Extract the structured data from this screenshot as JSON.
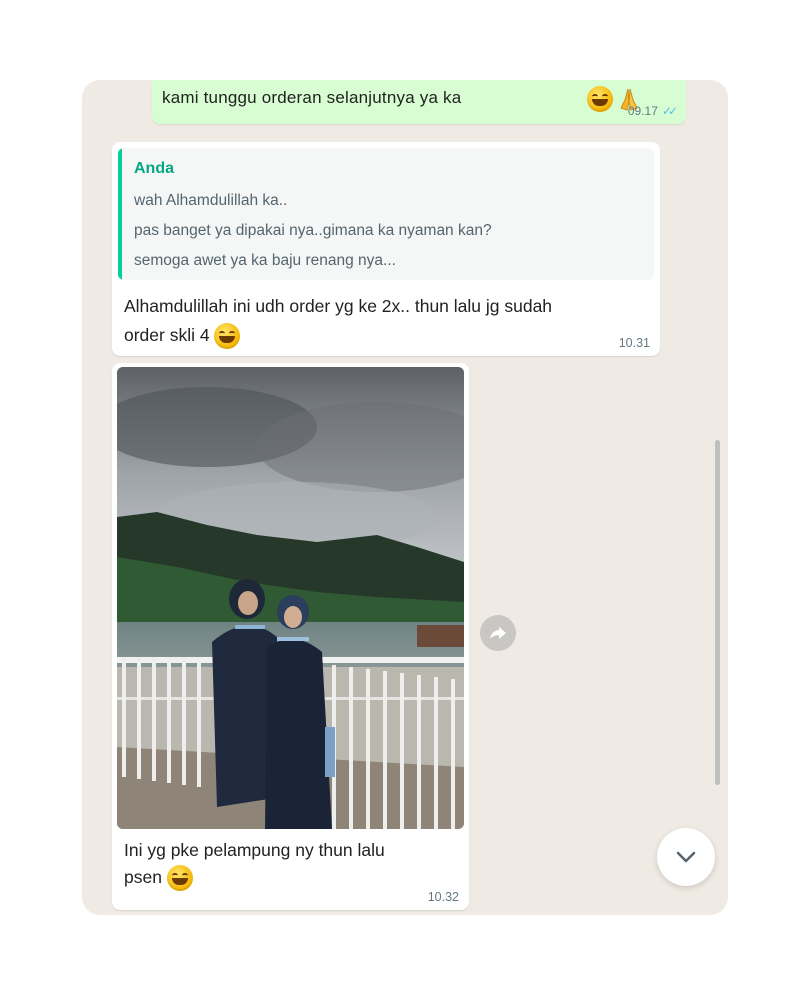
{
  "messages": {
    "outgoing_top": {
      "text": "kami tunggu orderan selanjutnya ya ka",
      "emojis": [
        "smiling-face-icon",
        "folded-hands-icon"
      ],
      "time": "09.17",
      "status": "read"
    },
    "reply": {
      "quote_author": "Anda",
      "quote_lines": [
        "wah Alhamdulillah ka..",
        "pas banget ya dipakai nya..gimana ka nyaman kan?",
        "semoga awet ya ka baju renang nya..."
      ],
      "text_line1": "Alhamdulillah ini udh order yg ke 2x.. thun lalu jg sudah",
      "text_line2": "order skli 4",
      "time": "10.31"
    },
    "image_message": {
      "caption_line1": "Ini yg pke pelampung ny thun lalu",
      "caption_line2": "psen",
      "time": "10.32"
    }
  },
  "colors": {
    "chat_background": "#efeae3",
    "outgoing_bubble": "#d9fdd3",
    "quote_accent": "#06cf9c",
    "read_ticks": "#53bdeb"
  },
  "icons": {
    "forward": "forward-arrow-icon",
    "scroll_down": "chevron-down-icon"
  }
}
